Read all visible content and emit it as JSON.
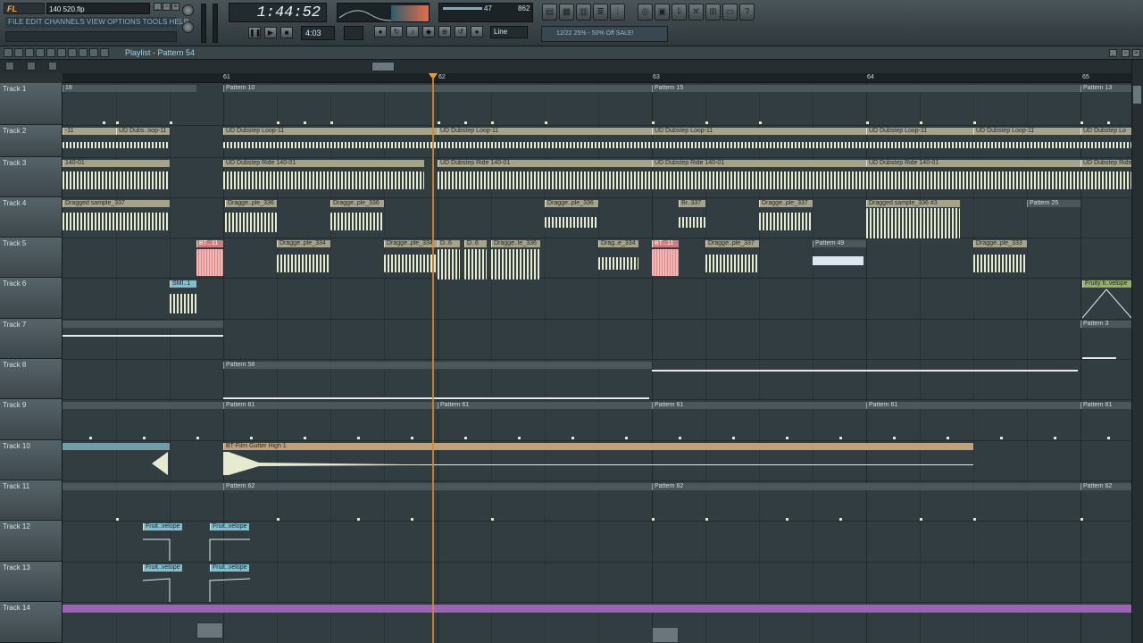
{
  "app": {
    "logo": "FL STUDIO",
    "file_name": "140 520.flp"
  },
  "menu": [
    "FILE",
    "EDIT",
    "CHANNELS",
    "VIEW",
    "OPTIONS",
    "TOOLS",
    "HELP"
  ],
  "transport": {
    "time": "1:44:52",
    "pattern": "4:03",
    "mode": "Line",
    "meter_value": "47",
    "cpu_value": "862",
    "news": "12/22 25% - 50% Off SALE!"
  },
  "playlist": {
    "title": "Playlist - Pattern 54"
  },
  "ruler": [
    "61",
    "62",
    "63",
    "64",
    "65"
  ],
  "tracks": [
    "Track 1",
    "Track 2",
    "Track 3",
    "Track 4",
    "Track 5",
    "Track 6",
    "Track 7",
    "Track 8",
    "Track 9",
    "Track 10",
    "Track 11",
    "Track 12",
    "Track 13",
    "Track 14"
  ],
  "clips": {
    "t1": [
      "18",
      "Pattern 10",
      "Pattern 15",
      "Pattern 13"
    ],
    "t2": [
      "-11",
      "UD Dubs..oop-11",
      "UD Dubstep Loop-11",
      "UD Dubstep Loop-11",
      "UD Dubstep Loop-11",
      "UD Dubstep Loop-11",
      "UD Dubstep Loop-11",
      "UD Dubstep Lo"
    ],
    "t3": [
      "140-01",
      "UD Dubstep Ride 140-01",
      "UD Dubstep Ride 140-01",
      "UD Dubstep Ride 140-01",
      "UD Dubstep Ride 140-01",
      "UD Dubstep Ride 140-01",
      "UD Dubs"
    ],
    "t4": [
      "Dragged sample_337",
      "Dragge..ple_336",
      "Dragge..ple_336",
      "Dragge..ple_336",
      "Br..337",
      "Dragge..ple_337",
      "Dragged sample_336 #3",
      "Pattern 25"
    ],
    "t5": [
      "BT...11",
      "Dragge..ple_334",
      "Dragge..ple_334",
      "D..6",
      "D..6",
      "Dragge..le_336",
      "Drag..e_334",
      "BT...11",
      "Dragge..ple_337",
      "Pattern 49",
      "Dragge..ple_333"
    ],
    "t6": [
      "SMI..1",
      "Fruity fi..velope"
    ],
    "t7": [
      "Pattern 3"
    ],
    "t8": [
      "Pattern 58"
    ],
    "t9": [
      "Pattern 61",
      "Pattern 61",
      "Pattern 61",
      "Pattern 61",
      "Pattern 61"
    ],
    "t10": [
      "BT-Film Gutter High 1"
    ],
    "t11": [
      "Pattern 62",
      "Pattern 62",
      "Pattern 62"
    ],
    "t12": [
      "Fruit..velope",
      "Fruit..velope"
    ],
    "t13": [
      "Fruit..velope",
      "Fruit..velope"
    ]
  },
  "colors": {
    "playhead": "#d98a33",
    "clip": "#a6a38a",
    "wave": "#e6ebd0",
    "purple": "#9b62b6"
  }
}
